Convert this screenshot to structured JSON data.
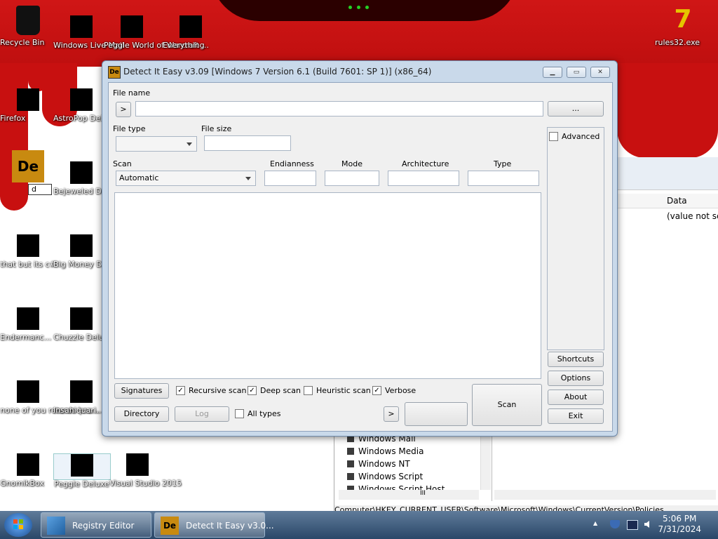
{
  "desktop": {
    "icons": [
      {
        "label": "Recycle Bin"
      },
      {
        "label": "Windows Live Mail"
      },
      {
        "label": "Peggle World of Warcraft ..."
      },
      {
        "label": "Everything"
      },
      {
        "label": "rules32.exe"
      },
      {
        "label": "Firefox"
      },
      {
        "label": "AstroPop Deluxe"
      },
      {
        "label": "d"
      },
      {
        "label": "Bejeweled Deluxe"
      },
      {
        "label": "that but its c#"
      },
      {
        "label": "Big Money Deluxe"
      },
      {
        "label": "Endermanc..."
      },
      {
        "label": "Chuzzle Deluxe"
      },
      {
        "label": "none of you retards kno..."
      },
      {
        "label": "Insaniquari... Deluxe"
      },
      {
        "label": "GnomikBox"
      },
      {
        "label": "Peggle Deluxe"
      },
      {
        "label": "Visual Studio 2015"
      }
    ]
  },
  "registry": {
    "column_data": "Data",
    "value_not_set": "(value not set)",
    "tree": [
      "Windows Mail",
      "Windows Media",
      "Windows NT",
      "Windows Script",
      "Windows Script Host"
    ],
    "scroll_mark": "III",
    "status": "Computer\\HKEY_CURRENT_USER\\Software\\Microsoft\\Windows\\CurrentVersion\\Policies"
  },
  "window": {
    "title": "Detect It Easy v3.09 [Windows 7 Version 6.1 (Build 7601: SP 1)] (x86_64)",
    "icon_text": "De",
    "file_name_label": "File name",
    "file_name_value": "",
    "browse_arrow": ">",
    "browse_button": "...",
    "file_type_label": "File type",
    "file_size_label": "File size",
    "file_size_value": "",
    "scan_label": "Scan",
    "scan_mode": "Automatic",
    "endianness_label": "Endianness",
    "mode_label": "Mode",
    "architecture_label": "Architecture",
    "type_label": "Type",
    "advanced_label": "Advanced",
    "buttons": {
      "signatures": "Signatures",
      "directory": "Directory",
      "log": "Log",
      "next": ">",
      "scan": "Scan",
      "shortcuts": "Shortcuts",
      "options": "Options",
      "about": "About",
      "exit": "Exit"
    },
    "checks": {
      "recursive": "Recursive scan",
      "deep": "Deep scan",
      "heuristic": "Heuristic scan",
      "verbose": "Verbose",
      "all_types": "All types"
    },
    "check_mark": "✓"
  },
  "taskbar": {
    "items": [
      {
        "label": "Registry Editor"
      },
      {
        "label": "Detect It Easy v3.0..."
      }
    ],
    "time": "5:06 PM",
    "date": "7/31/2024",
    "tray_arrow": "▲"
  },
  "colors": {
    "wallpaper_red": "#c30f0f",
    "window_frame": "#c9d9ea",
    "taskbar": "#2a4768"
  }
}
